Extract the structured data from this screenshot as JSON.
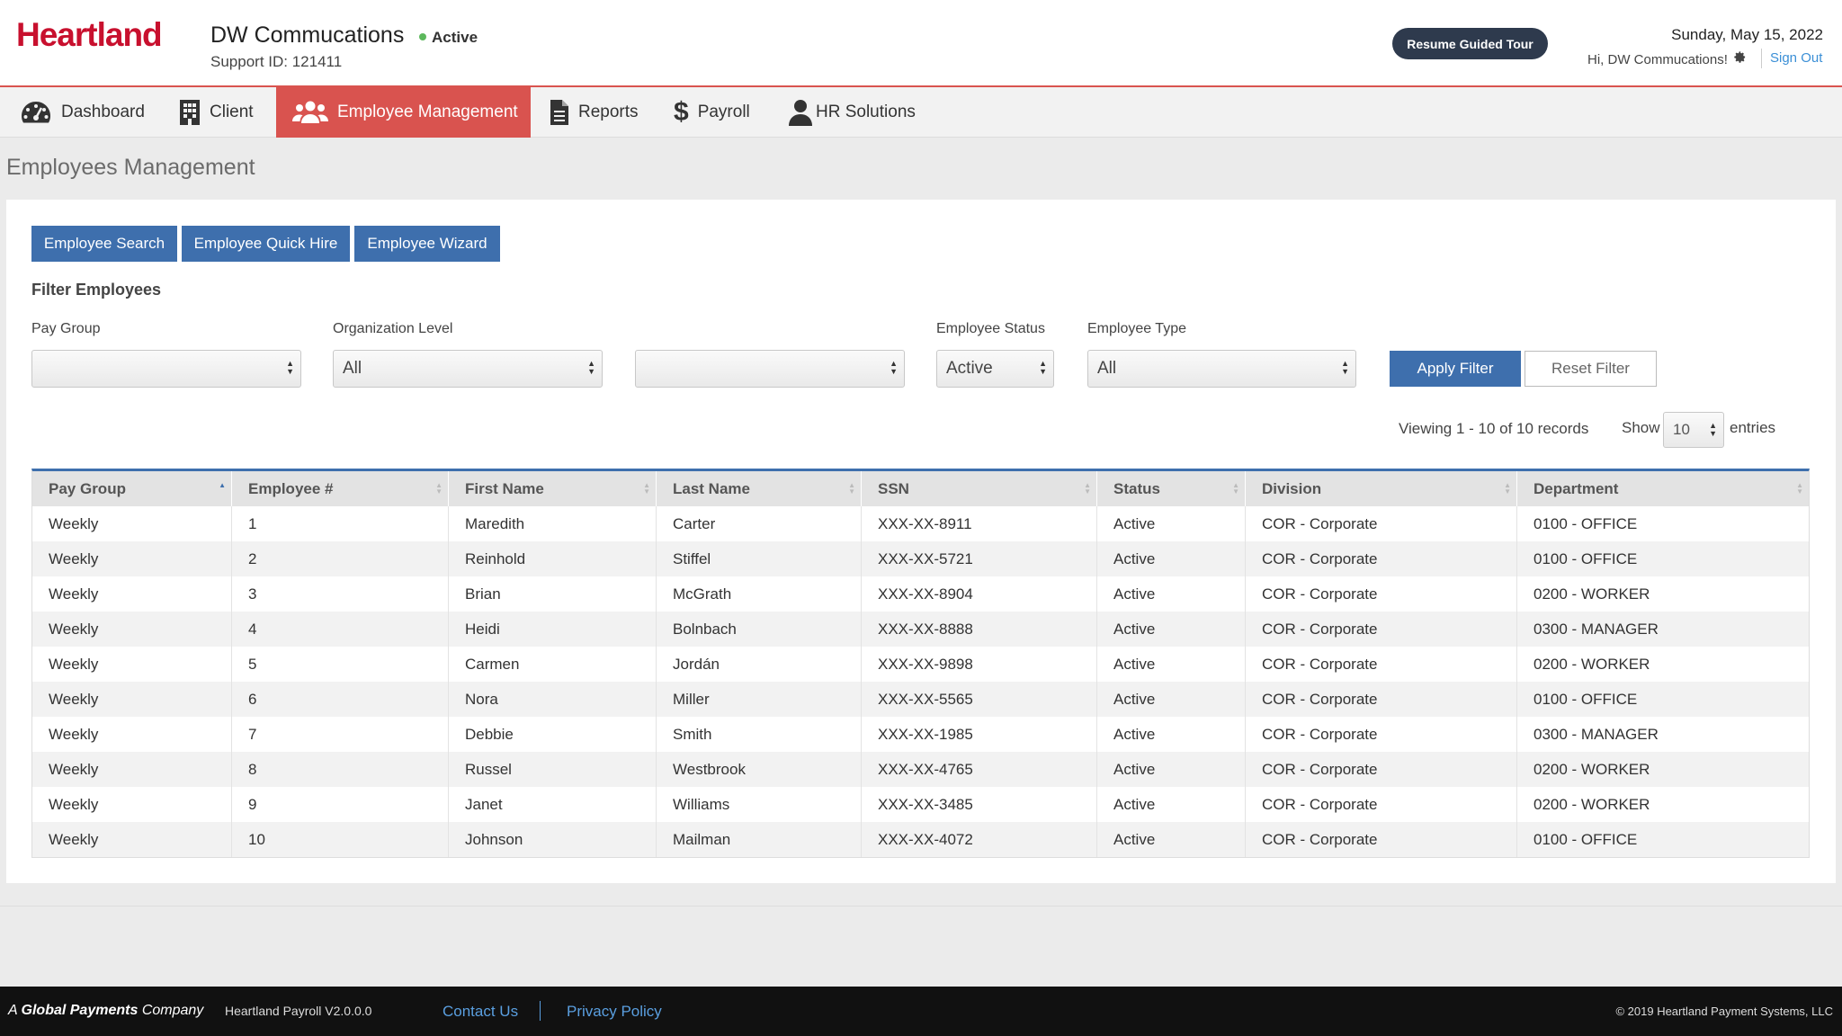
{
  "header": {
    "logo_text": "Heartland",
    "client_name": "DW Commucations",
    "client_status": "Active",
    "support_id": "Support ID: 121411",
    "tour_button": "Resume Guided Tour",
    "date": "Sunday, May 15, 2022",
    "greeting": "Hi, DW Commucations!",
    "sign_out": "Sign Out"
  },
  "nav": {
    "items": [
      {
        "label": "Dashboard",
        "icon": "dashboard-icon"
      },
      {
        "label": "Client",
        "icon": "building-icon"
      },
      {
        "label": "Employee Management",
        "icon": "users-icon",
        "active": true
      },
      {
        "label": "Reports",
        "icon": "document-icon"
      },
      {
        "label": "Payroll",
        "icon": "dollar-icon"
      },
      {
        "label": "HR Solutions",
        "icon": "user-icon"
      }
    ]
  },
  "page": {
    "title": "Employees Management"
  },
  "actions": {
    "employee_search": "Employee Search",
    "quick_hire": "Employee Quick Hire",
    "wizard": "Employee Wizard"
  },
  "filters": {
    "title": "Filter Employees",
    "pay_group_label": "Pay Group",
    "pay_group_value": "",
    "org_level_label": "Organization Level",
    "org_level_value": "All",
    "org_sublevel_value": "",
    "employee_status_label": "Employee Status",
    "employee_status_value": "Active",
    "employee_type_label": "Employee Type",
    "employee_type_value": "All",
    "apply": "Apply Filter",
    "reset": "Reset Filter"
  },
  "paging": {
    "viewing": "Viewing 1 - 10 of 10 records",
    "show_label": "Show",
    "show_value": "10",
    "entries_label": "entries"
  },
  "table": {
    "columns": [
      "Pay Group",
      "Employee #",
      "First Name",
      "Last Name",
      "SSN",
      "Status",
      "Division",
      "Department"
    ],
    "rows": [
      [
        "Weekly",
        "1",
        "Maredith",
        "Carter",
        "XXX-XX-8911",
        "Active",
        "COR - Corporate",
        "0100 - OFFICE"
      ],
      [
        "Weekly",
        "2",
        "Reinhold",
        "Stiffel",
        "XXX-XX-5721",
        "Active",
        "COR - Corporate",
        "0100 - OFFICE"
      ],
      [
        "Weekly",
        "3",
        "Brian",
        "McGrath",
        "XXX-XX-8904",
        "Active",
        "COR - Corporate",
        "0200 - WORKER"
      ],
      [
        "Weekly",
        "4",
        "Heidi",
        "Bolnbach",
        "XXX-XX-8888",
        "Active",
        "COR - Corporate",
        "0300 - MANAGER"
      ],
      [
        "Weekly",
        "5",
        "Carmen",
        "Jordán",
        "XXX-XX-9898",
        "Active",
        "COR - Corporate",
        "0200 - WORKER"
      ],
      [
        "Weekly",
        "6",
        "Nora",
        "Miller",
        "XXX-XX-5565",
        "Active",
        "COR - Corporate",
        "0100 - OFFICE"
      ],
      [
        "Weekly",
        "7",
        "Debbie",
        "Smith",
        "XXX-XX-1985",
        "Active",
        "COR - Corporate",
        "0300 - MANAGER"
      ],
      [
        "Weekly",
        "8",
        "Russel",
        "Westbrook",
        "XXX-XX-4765",
        "Active",
        "COR - Corporate",
        "0200 - WORKER"
      ],
      [
        "Weekly",
        "9",
        "Janet",
        "Williams",
        "XXX-XX-3485",
        "Active",
        "COR - Corporate",
        "0200 - WORKER"
      ],
      [
        "Weekly",
        "10",
        "Johnson",
        "Mailman",
        "XXX-XX-4072",
        "Active",
        "COR - Corporate",
        "0100 - OFFICE"
      ]
    ]
  },
  "footer": {
    "company_prefix": "A",
    "company_bold": "Global Payments",
    "company_suffix": "Company",
    "version": "Heartland Payroll V2.0.0.0",
    "contact": "Contact Us",
    "privacy": "Privacy Policy",
    "copyright": "© 2019 Heartland Payment Systems, LLC"
  },
  "colors": {
    "brand_red": "#c8102e",
    "nav_active": "#d9534f",
    "primary_blue": "#3e6fad",
    "tour_button": "#2e3a4d",
    "link_blue": "#3b8fd6",
    "status_green": "#5cb85c"
  }
}
